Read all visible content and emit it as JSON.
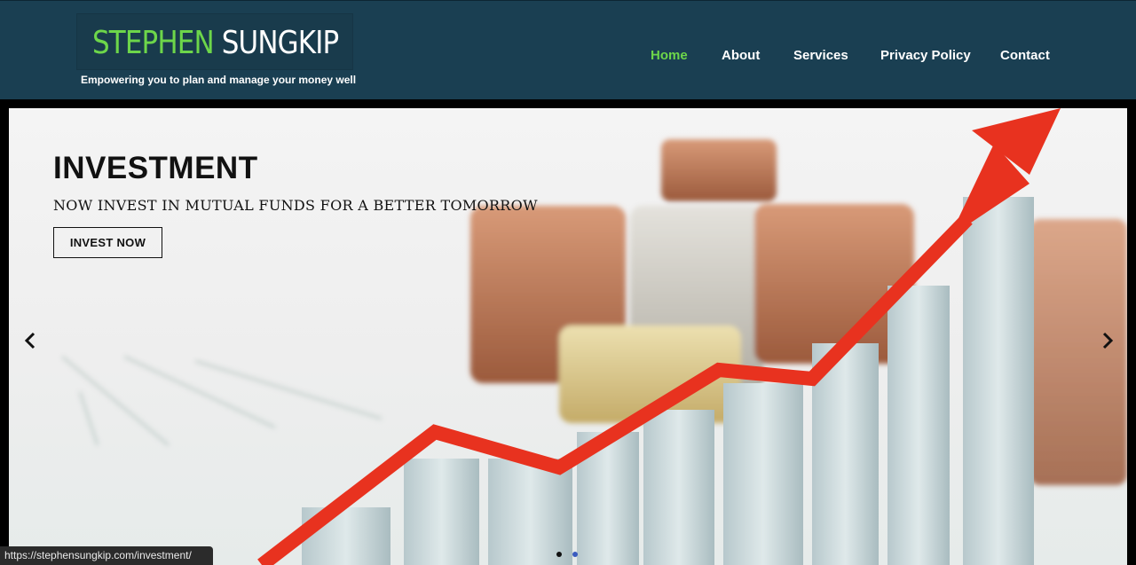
{
  "header": {
    "logo_first": "STEPHEN",
    "logo_last": "SUNGKIP",
    "tagline": "Empowering you to plan and manage your money well"
  },
  "nav": {
    "items": [
      {
        "label": "Home",
        "active": true
      },
      {
        "label": "About"
      },
      {
        "label": "Services"
      },
      {
        "label": "Privacy Policy"
      },
      {
        "label": "Contact"
      }
    ]
  },
  "slide": {
    "title": "INVESTMENT",
    "subtitle": "NOW INVEST IN MUTUAL FUNDS FOR A BETTER TOMORROW",
    "button_label": "INVEST NOW",
    "image_description": "stacks of coins with a rising red arrow over bar graph",
    "prev_icon": "chevron-left-icon",
    "next_icon": "chevron-right-icon",
    "current_slide": 2,
    "total_slides": 2
  },
  "status_bar": {
    "url": "https://stephensungkip.com/investment/"
  },
  "colors": {
    "header_bg": "#1a3f52",
    "logo_accent": "#6dd64a",
    "active_nav": "#6dd64a",
    "arrow_red": "#e8321f"
  }
}
